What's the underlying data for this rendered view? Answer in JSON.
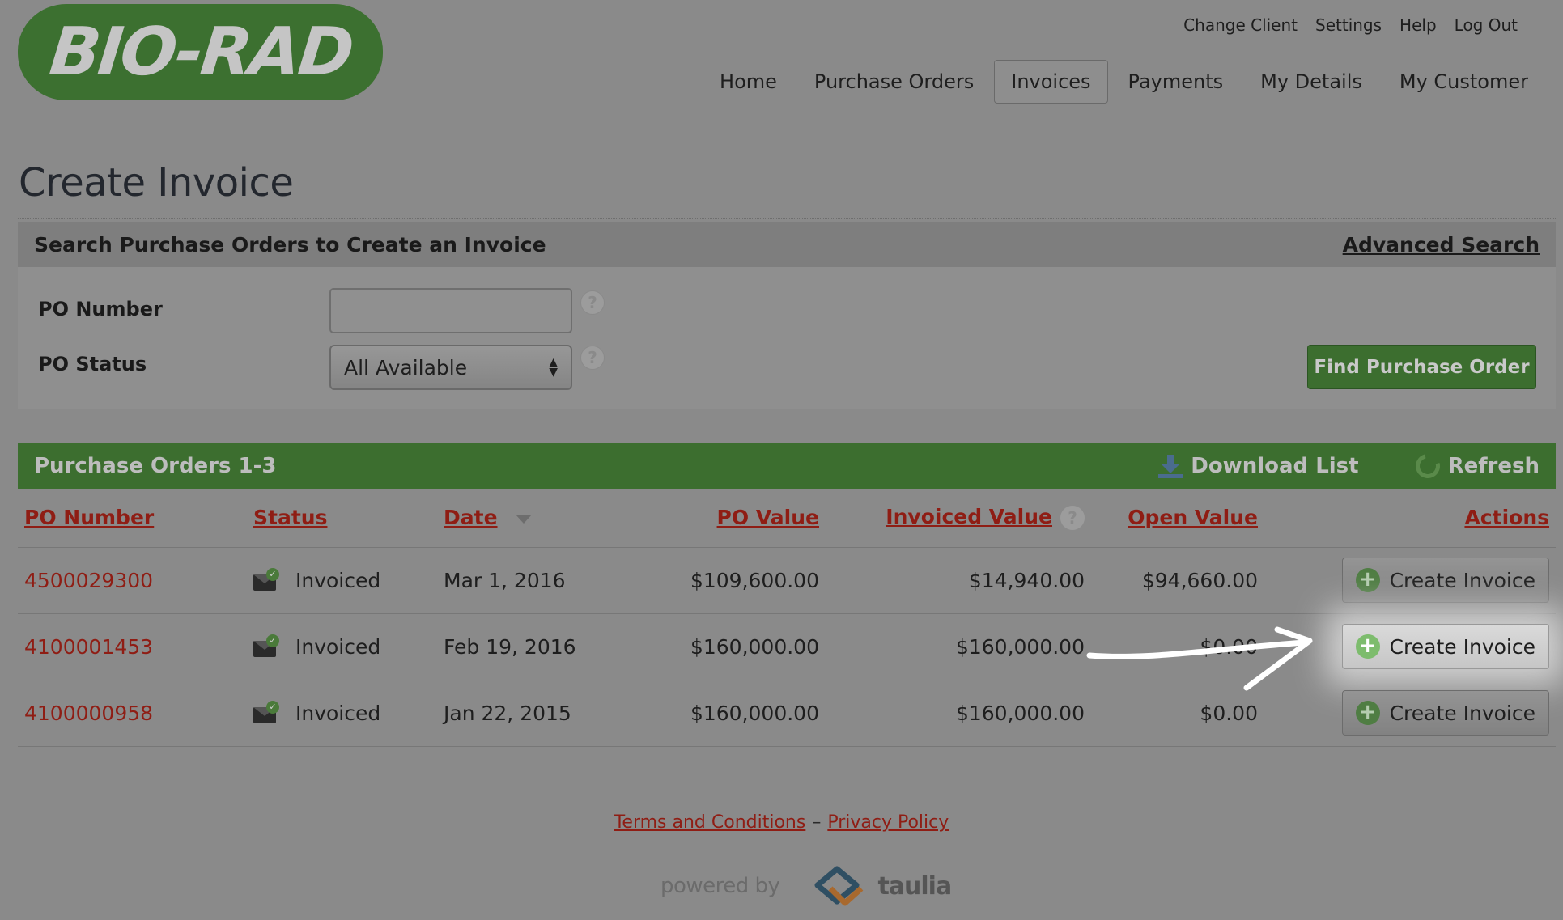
{
  "brand": {
    "logo_text": "BIO-RAD"
  },
  "utility_nav": [
    "Change Client",
    "Settings",
    "Help",
    "Log Out"
  ],
  "main_nav": [
    {
      "label": "Home",
      "active": false
    },
    {
      "label": "Purchase Orders",
      "active": false
    },
    {
      "label": "Invoices",
      "active": true
    },
    {
      "label": "Payments",
      "active": false
    },
    {
      "label": "My Details",
      "active": false
    },
    {
      "label": "My Customer",
      "active": false
    }
  ],
  "page_title": "Create Invoice",
  "search": {
    "heading": "Search Purchase Orders to Create an Invoice",
    "advanced_link": "Advanced Search",
    "po_number_label": "PO Number",
    "po_number_value": "",
    "po_status_label": "PO Status",
    "po_status_value": "All Available",
    "help_glyph": "?",
    "find_button": "Find Purchase Order"
  },
  "results": {
    "title": "Purchase Orders 1-3",
    "download_label": "Download List",
    "refresh_label": "Refresh",
    "columns": [
      "PO Number",
      "Status",
      "Date",
      "PO Value",
      "Invoiced Value",
      "Open Value",
      "Actions"
    ],
    "rows": [
      {
        "po_number": "4500029300",
        "status": "Invoiced",
        "date": "Mar 1, 2016",
        "po_value": "$109,600.00",
        "invoiced_value": "$14,940.00",
        "open_value": "$94,660.00",
        "action": "Create Invoice"
      },
      {
        "po_number": "4100001453",
        "status": "Invoiced",
        "date": "Feb 19, 2016",
        "po_value": "$160,000.00",
        "invoiced_value": "$160,000.00",
        "open_value": "$0.00",
        "action": "Create Invoice"
      },
      {
        "po_number": "4100000958",
        "status": "Invoiced",
        "date": "Jan 22, 2015",
        "po_value": "$160,000.00",
        "invoiced_value": "$160,000.00",
        "open_value": "$0.00",
        "action": "Create Invoice"
      }
    ]
  },
  "footer": {
    "terms": "Terms and Conditions",
    "separator": "–",
    "privacy": "Privacy Policy",
    "powered_by": "powered by",
    "powered_brand": "taulia"
  }
}
